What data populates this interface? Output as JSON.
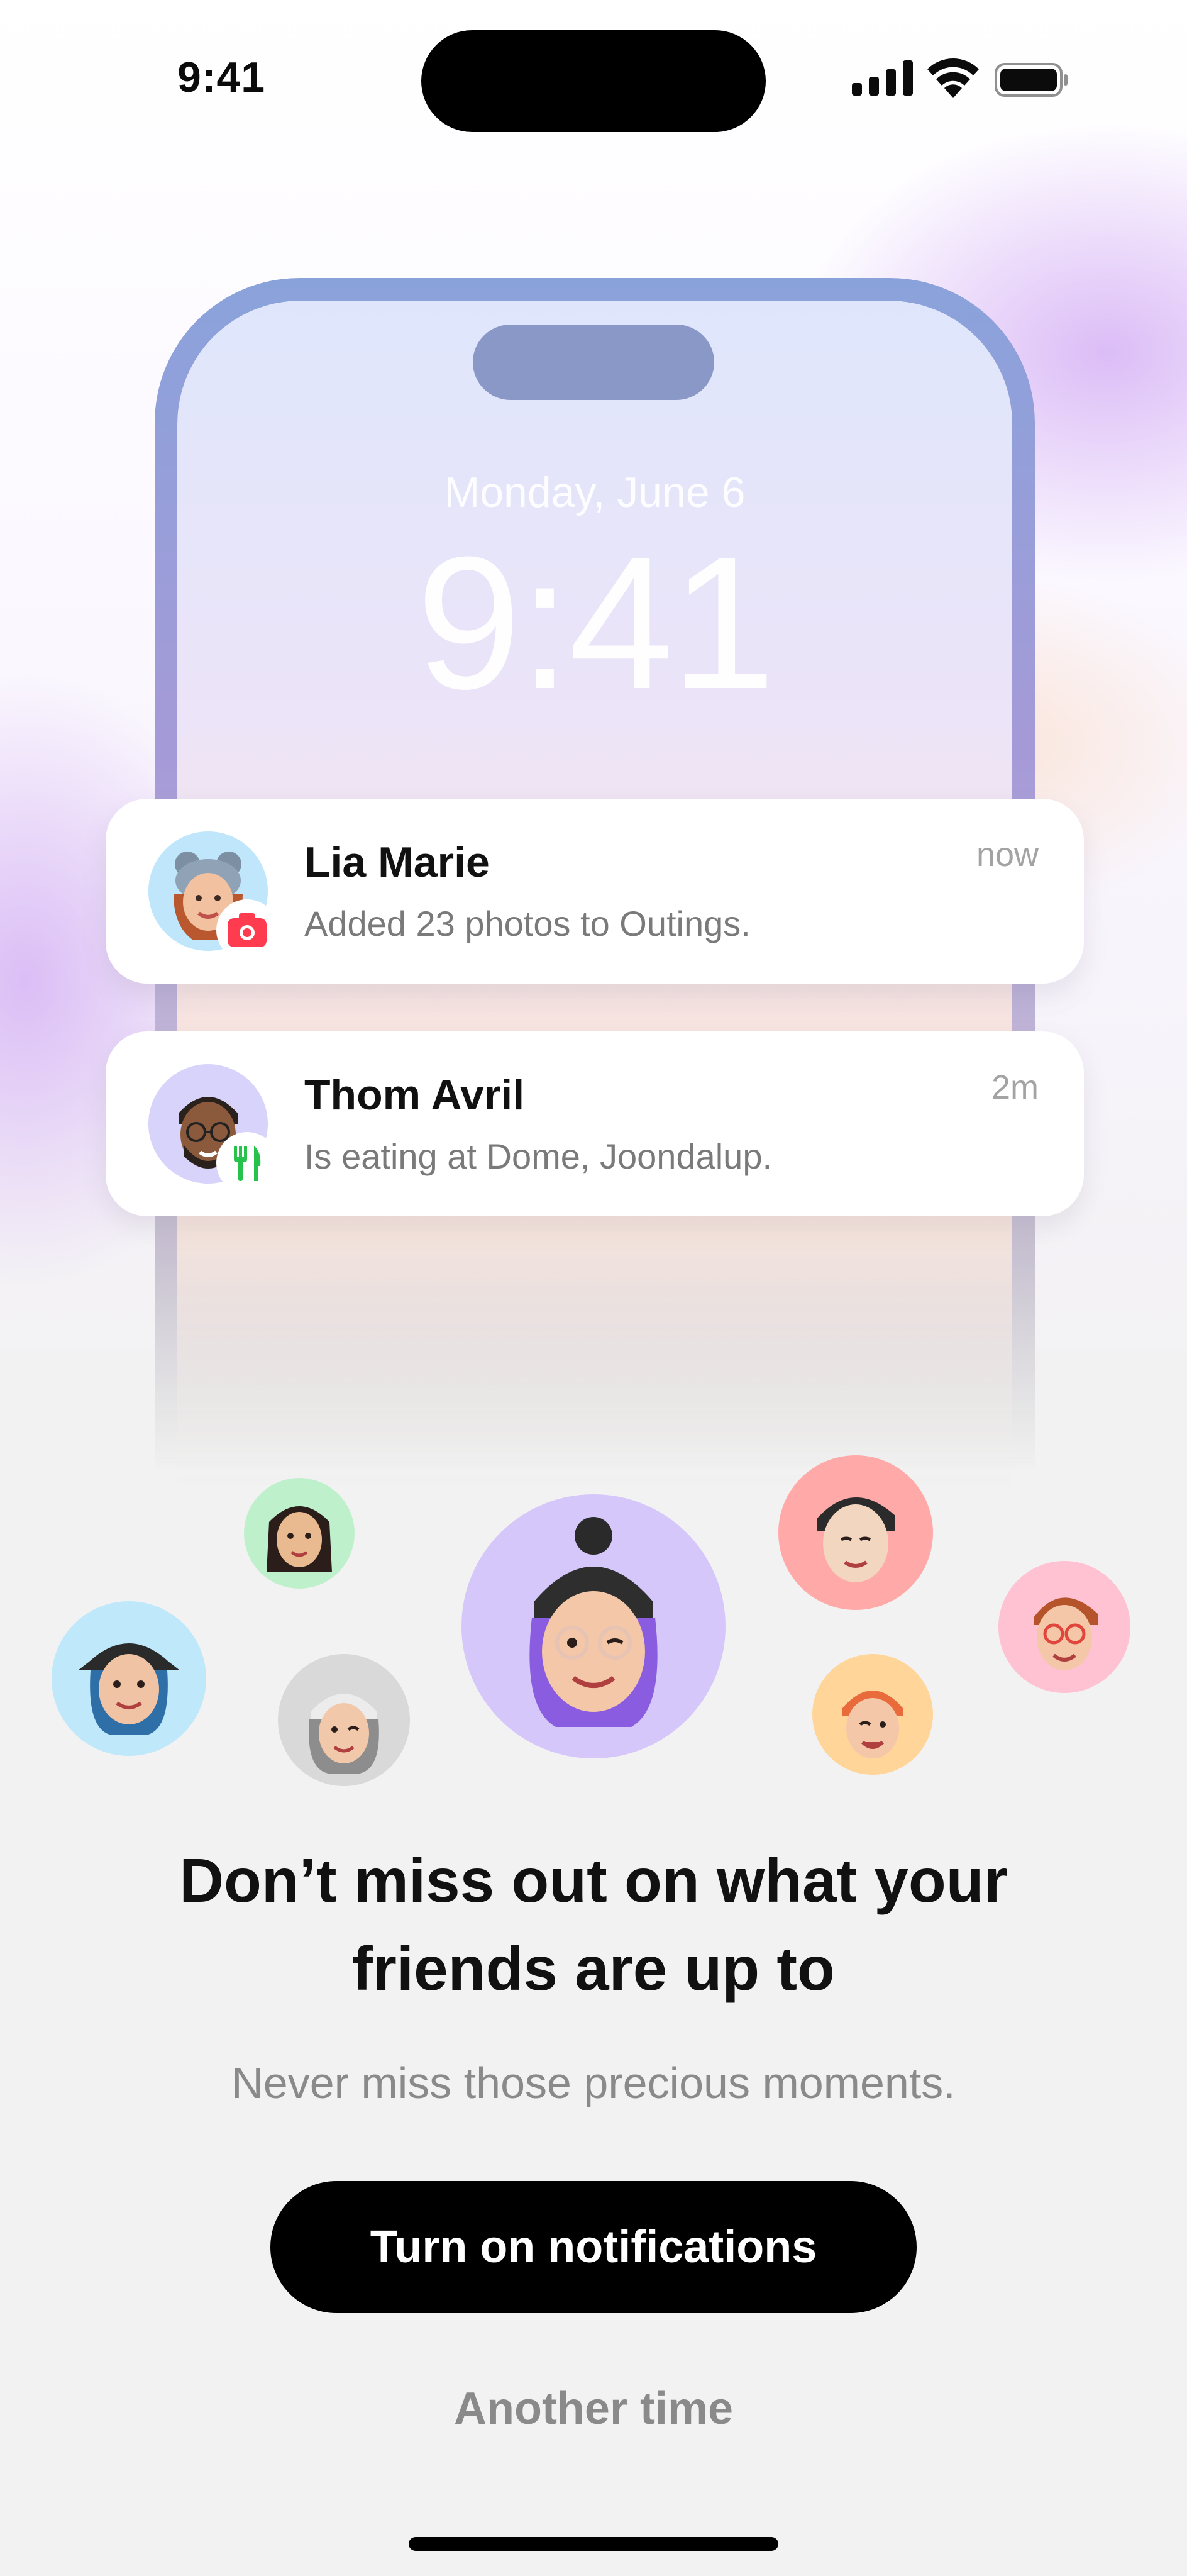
{
  "status_bar": {
    "time": "9:41",
    "icons": [
      "signal-icon",
      "wifi-icon",
      "battery-icon"
    ]
  },
  "lock_screen": {
    "date": "Monday, June 6",
    "time": "9:41"
  },
  "notifications": [
    {
      "name": "Lia Marie",
      "message": "Added 23 photos to Outings.",
      "time": "now",
      "avatar_color": "#bfe6fb",
      "badge_icon": "camera-icon",
      "badge_color": "#ff3b50"
    },
    {
      "name": "Thom Avril",
      "message": "Is eating at Dome, Joondalup.",
      "time": "2m",
      "avatar_color": "#d7d3fb",
      "badge_icon": "fork-knife-icon",
      "badge_color": "#27c24c"
    }
  ],
  "memoji_bubbles": [
    {
      "name": "memoji-green",
      "color": "#bff0cc"
    },
    {
      "name": "memoji-blue",
      "color": "#bfe9fb"
    },
    {
      "name": "memoji-gray",
      "color": "#d9d9d9"
    },
    {
      "name": "memoji-purple-main",
      "color": "#d6c7fb"
    },
    {
      "name": "memoji-red",
      "color": "#ffaaa8"
    },
    {
      "name": "memoji-orange",
      "color": "#ffd59a"
    },
    {
      "name": "memoji-pink",
      "color": "#ffc2d2"
    }
  ],
  "onboarding": {
    "headline_line1": "Don’t miss out on what your",
    "headline_line2": "friends are up to",
    "subtext": "Never miss those precious moments.",
    "primary_button": "Turn on notifications",
    "secondary_button": "Another time"
  }
}
